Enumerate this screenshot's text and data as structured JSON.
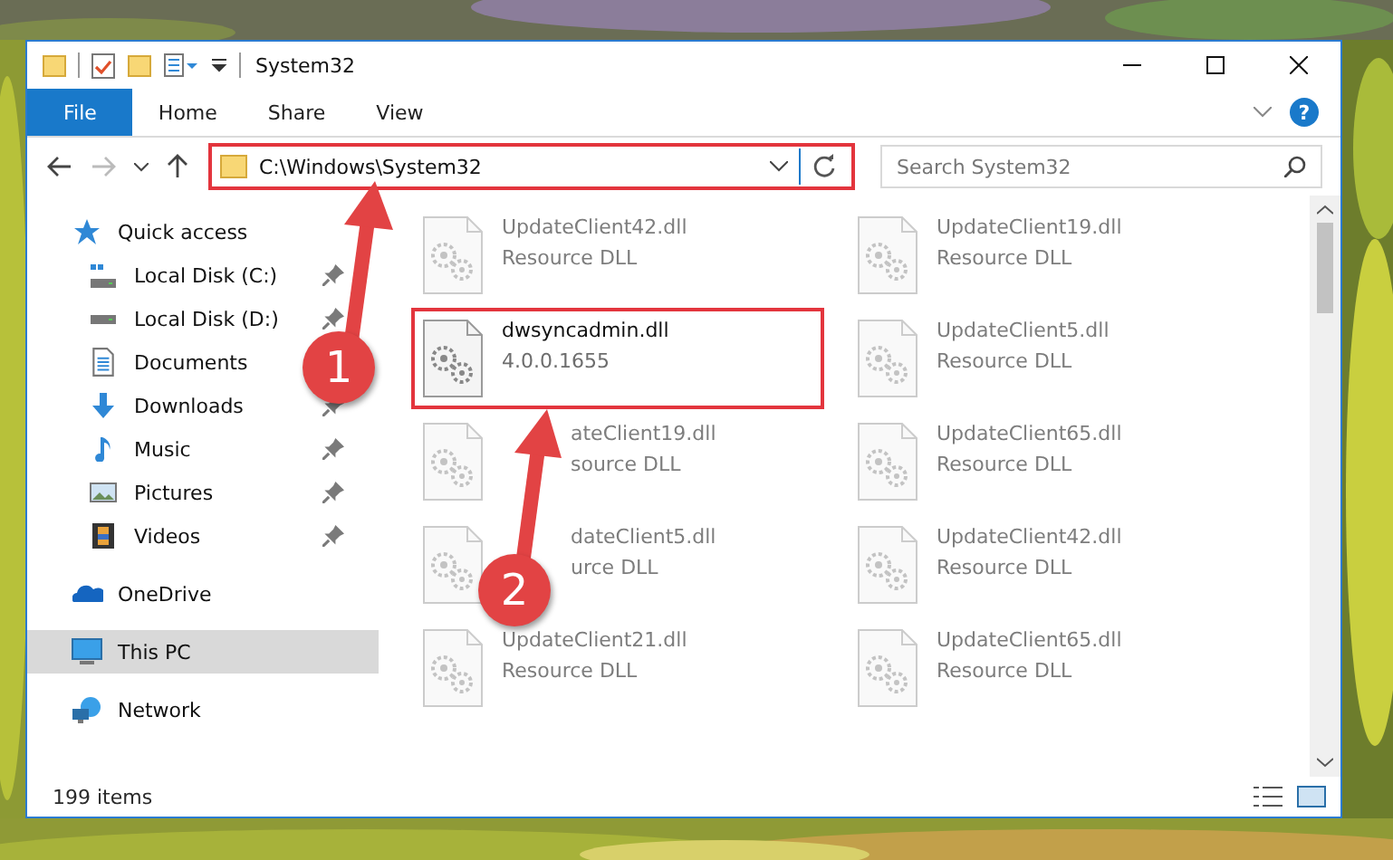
{
  "window": {
    "title": "System32"
  },
  "ribbon": {
    "tabs": [
      {
        "label": "File",
        "kind": "file",
        "selected": false
      },
      {
        "label": "Home",
        "kind": "tab",
        "selected": false
      },
      {
        "label": "Share",
        "kind": "tab",
        "selected": false
      },
      {
        "label": "View",
        "kind": "tab",
        "selected": false
      }
    ],
    "help": "?"
  },
  "address": {
    "path": "C:\\Windows\\System32",
    "highlighted": true
  },
  "search": {
    "placeholder": "Search System32"
  },
  "sidebar": {
    "items": [
      {
        "label": "Quick access",
        "kind": "star",
        "selected": false,
        "children": [
          {
            "label": "Local Disk (C:)",
            "kind": "drive_c",
            "pinned": true,
            "selected": false
          },
          {
            "label": "Local Disk (D:)",
            "kind": "drive",
            "pinned": true,
            "selected": false
          },
          {
            "label": "Documents",
            "kind": "documents",
            "selected": false
          },
          {
            "label": "Downloads",
            "kind": "downloads",
            "pinned": true,
            "selected": false
          },
          {
            "label": "Music",
            "kind": "music",
            "pinned": true,
            "selected": false
          },
          {
            "label": "Pictures",
            "kind": "pictures",
            "pinned": true,
            "selected": false
          },
          {
            "label": "Videos",
            "kind": "videos",
            "pinned": true,
            "selected": false
          }
        ]
      },
      {
        "label": "OneDrive",
        "kind": "onedrive",
        "selected": false
      },
      {
        "label": "This PC",
        "kind": "pc",
        "selected": true
      },
      {
        "label": "Network",
        "kind": "network",
        "selected": false
      }
    ]
  },
  "files": [
    {
      "name": "UpdateClient42.dll",
      "detail": "Resource DLL",
      "blurred": true,
      "highlighted": false,
      "covered": false
    },
    {
      "name": "UpdateClient19.dll",
      "detail": "Resource DLL",
      "blurred": true,
      "highlighted": false,
      "covered": false
    },
    {
      "name": "dwsyncadmin.dll",
      "detail": "4.0.0.1655",
      "blurred": false,
      "highlighted": true,
      "covered": false
    },
    {
      "name": "UpdateClient5.dll",
      "detail": "Resource DLL",
      "blurred": true,
      "highlighted": false,
      "covered": false
    },
    {
      "name": "ateClient19.dll",
      "detail": "source DLL",
      "blurred": true,
      "highlighted": false,
      "covered": true
    },
    {
      "name": "UpdateClient65.dll",
      "detail": "Resource DLL",
      "blurred": true,
      "highlighted": false,
      "covered": false
    },
    {
      "name": "dateClient5.dll",
      "detail": "urce DLL",
      "blurred": true,
      "highlighted": false,
      "covered": true
    },
    {
      "name": "UpdateClient42.dll",
      "detail": "Resource DLL",
      "blurred": true,
      "highlighted": false,
      "covered": false
    },
    {
      "name": "UpdateClient21.dll",
      "detail": "Resource DLL",
      "blurred": true,
      "highlighted": false,
      "covered": false
    },
    {
      "name": "UpdateClient65.dll",
      "detail": "Resource DLL",
      "blurred": true,
      "highlighted": false,
      "covered": false
    }
  ],
  "status_bar": {
    "count": "199 items"
  },
  "annotations": [
    {
      "label": "1"
    },
    {
      "label": "2"
    }
  ]
}
